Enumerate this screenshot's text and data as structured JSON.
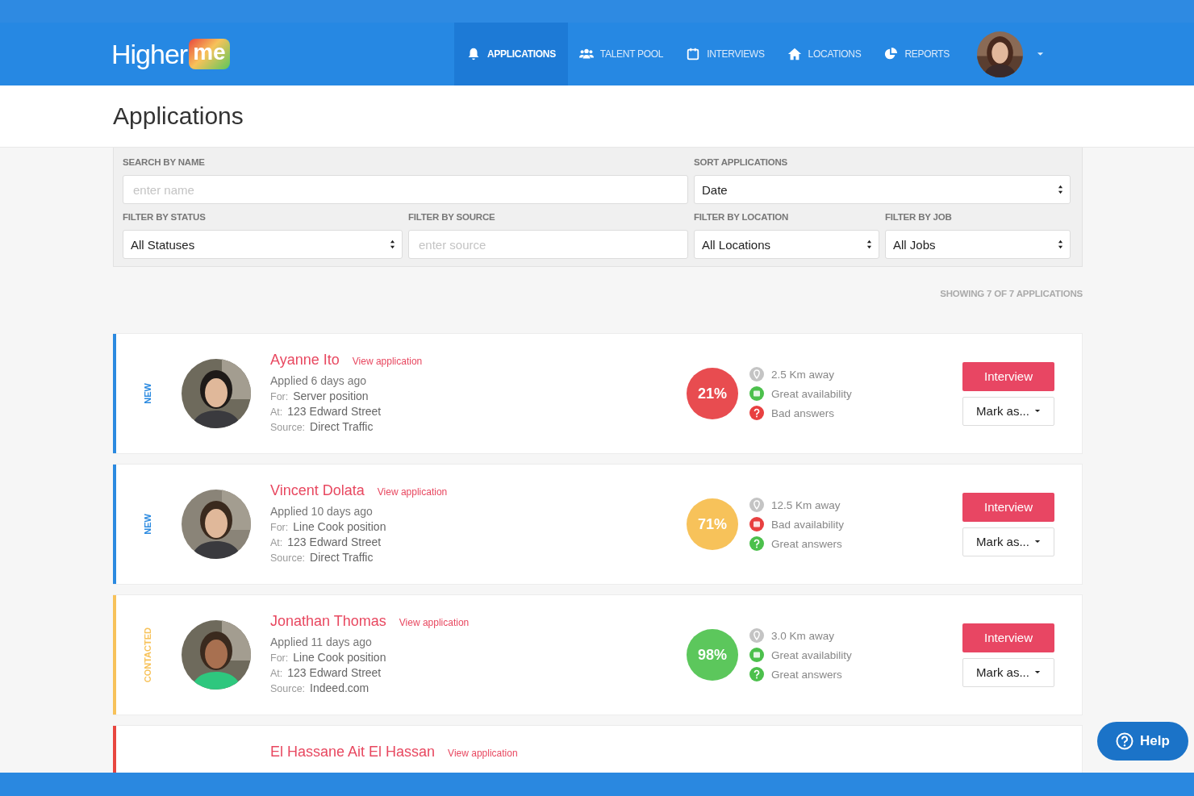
{
  "logo": {
    "text": "Higher",
    "badge": "me"
  },
  "nav": [
    {
      "label": "APPLICATIONS",
      "selected": true
    },
    {
      "label": "TALENT POOL",
      "selected": false
    },
    {
      "label": "INTERVIEWS",
      "selected": false
    },
    {
      "label": "LOCATIONS",
      "selected": false
    },
    {
      "label": "REPORTS",
      "selected": false
    }
  ],
  "page_title": "Applications",
  "filters": [
    {
      "label": "SEARCH BY NAME",
      "kind": "input",
      "placeholder": "enter name"
    },
    {
      "label": "SORT APPLICATIONS",
      "kind": "select",
      "value": "Date"
    },
    {
      "label": "FILTER BY STATUS",
      "kind": "select",
      "value": "All Statuses"
    },
    {
      "label": "FILTER BY SOURCE",
      "kind": "input",
      "placeholder": "enter source"
    },
    {
      "label": "FILTER BY LOCATION",
      "kind": "select",
      "value": "All Locations"
    },
    {
      "label": "FILTER BY JOB",
      "kind": "select",
      "value": "All Jobs"
    }
  ],
  "result_count": "SHOWING 7 OF 7 APPLICATIONS",
  "applications": [
    {
      "status": "NEW",
      "color": "#2b8ae0",
      "name": "Ayanne Ito",
      "link": "View application",
      "applied": "Applied 6 days ago",
      "for_label": "For:",
      "position": "Server position",
      "at_label": "At:",
      "address": "123 Edward Street",
      "source_label": "Source:",
      "source": "Direct Traffic",
      "score": {
        "text": "21%",
        "color": "#e84c50"
      },
      "indicators": [
        {
          "kind": "distance",
          "text": "2.5 Km away"
        },
        {
          "kind": "availability",
          "good": true,
          "text": "Great availability"
        },
        {
          "kind": "answers",
          "good": false,
          "text": "Bad answers"
        }
      ],
      "primary": "Interview",
      "secondary": "Mark as..."
    },
    {
      "status": "NEW",
      "color": "#2b8ae0",
      "name": "Vincent Dolata",
      "link": "View application",
      "applied": "Applied 10 days ago",
      "for_label": "For:",
      "position": "Line Cook position",
      "at_label": "At:",
      "address": "123 Edward Street",
      "source_label": "Source:",
      "source": "Direct Traffic",
      "score": {
        "text": "71%",
        "color": "#f7c25a"
      },
      "indicators": [
        {
          "kind": "distance",
          "text": "12.5 Km away"
        },
        {
          "kind": "availability",
          "good": false,
          "text": "Bad availability"
        },
        {
          "kind": "answers",
          "good": true,
          "text": "Great answers"
        }
      ],
      "primary": "Interview",
      "secondary": "Mark as..."
    },
    {
      "status": "CONTACTED",
      "color": "#f7c25a",
      "name": "Jonathan Thomas",
      "link": "View application",
      "applied": "Applied 11 days ago",
      "for_label": "For:",
      "position": "Line Cook position",
      "at_label": "At:",
      "address": "123 Edward Street",
      "source_label": "Source:",
      "source": "Indeed.com",
      "score": {
        "text": "98%",
        "color": "#5cc75c"
      },
      "indicators": [
        {
          "kind": "distance",
          "text": "3.0 Km away"
        },
        {
          "kind": "availability",
          "good": true,
          "text": "Great availability"
        },
        {
          "kind": "answers",
          "good": true,
          "text": "Great answers"
        }
      ],
      "primary": "Interview",
      "secondary": "Mark as..."
    },
    {
      "color": "#e8463f",
      "name": "El Hassane Ait El Hassan",
      "link": "View application"
    }
  ],
  "help": "Help"
}
